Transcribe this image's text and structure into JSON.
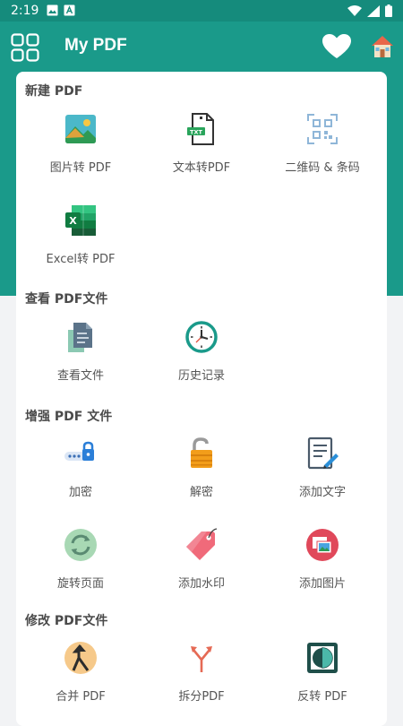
{
  "status_bar": {
    "time": "2:19"
  },
  "app_bar": {
    "title": "My PDF"
  },
  "sections": [
    {
      "title": "新建 PDF",
      "items": [
        {
          "label": "图片转 PDF",
          "icon": "image-icon"
        },
        {
          "label": "文本转PDF",
          "icon": "txt-file-icon"
        },
        {
          "label": "二维码 & 条码",
          "icon": "qr-code-icon"
        },
        {
          "label": "Excel转 PDF",
          "icon": "excel-icon"
        }
      ]
    },
    {
      "title": "查看 PDF文件",
      "items": [
        {
          "label": "查看文件",
          "icon": "documents-icon"
        },
        {
          "label": "历史记录",
          "icon": "clock-icon"
        }
      ]
    },
    {
      "title": "增强 PDF 文件",
      "items": [
        {
          "label": "加密",
          "icon": "password-lock-icon"
        },
        {
          "label": "解密",
          "icon": "unlock-icon"
        },
        {
          "label": "添加文字",
          "icon": "edit-text-icon"
        },
        {
          "label": "旋转页面",
          "icon": "rotate-icon"
        },
        {
          "label": "添加水印",
          "icon": "tag-icon"
        },
        {
          "label": "添加图片",
          "icon": "add-picture-icon"
        }
      ]
    },
    {
      "title": "修改 PDF文件",
      "items": [
        {
          "label": "合并 PDF",
          "icon": "merge-icon"
        },
        {
          "label": "拆分PDF",
          "icon": "split-icon"
        },
        {
          "label": "反转 PDF",
          "icon": "invert-icon"
        }
      ]
    }
  ],
  "colors": {
    "primary": "#1a9a8a",
    "status_bar": "#158b7c",
    "card": "#ffffff",
    "background": "#f2f3f5"
  }
}
